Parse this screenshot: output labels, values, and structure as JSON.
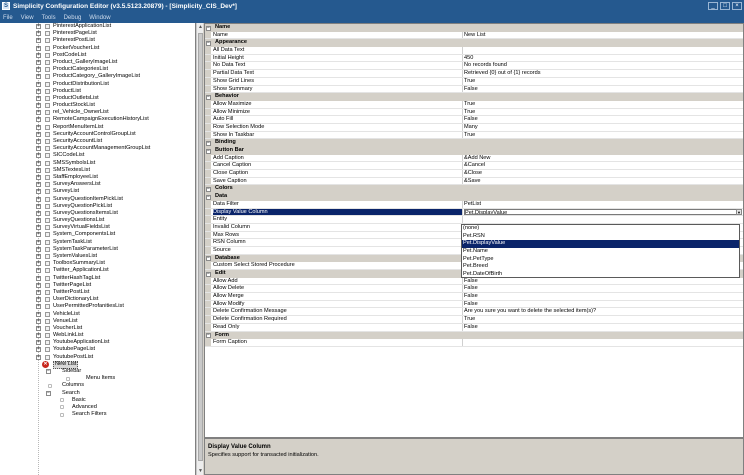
{
  "window": {
    "title": "Simplicity Configuration Editor (v3.5.5123.20879) - [Simplicity_CIS_Dev*]"
  },
  "menu": [
    "File",
    "View",
    "Tools",
    "Debug",
    "Window"
  ],
  "tree": {
    "items": [
      "PinterestApplicationList",
      "PinterestPageList",
      "PinterestPostList",
      "PocketVoucherList",
      "PostCodeList",
      "Product_GalleryImageList",
      "ProductCategoriesList",
      "ProductCategory_GalleryImageList",
      "ProductDistributionList",
      "ProductList",
      "ProductOutletsList",
      "ProductStockList",
      "rel_Vehicle_OwnerList",
      "RemoteCampaignExecutionHistoryList",
      "ReportMenuItemList",
      "SecurityAccountControlGroupList",
      "SecurityAccountList",
      "SecurityAccountManagementGroupList",
      "SICCodeList",
      "SMSSymbolsList",
      "SMSTextesList",
      "StaffEmployeeList",
      "SurveyAnswersList",
      "SurveyList",
      "SurveyQuestionItemPickList",
      "SurveyQuestionPickList",
      "SurveyQuestionsItemsList",
      "SurveyQuestionsList",
      "SurveyVirtualFieldsList",
      "System_ComponentsList",
      "SystemTaskList",
      "SystemTaskParameterList",
      "SystemValuesList",
      "ToolboxSummaryList",
      "Twitter_ApplicationList",
      "TwitterHashTagList",
      "TwitterPageList",
      "TwitterPostList",
      "UserDictionaryList",
      "UserPermittedProfanitiesList",
      "VehicleList",
      "VenueList",
      "VoucherList",
      "WebLinkList",
      "YoutubeApplicationList",
      "YoutubePageList",
      "YoutubePostList"
    ],
    "new_list": "New List",
    "children": {
      "sidebar": "Sidebar",
      "menu_items": "Menu Items",
      "columns": "Columns",
      "search": "Search",
      "basic": "Basic",
      "advanced": "Advanced",
      "search_filters": "Search Filters"
    }
  },
  "grid": {
    "rows": [
      {
        "type": "category",
        "name": "Name"
      },
      {
        "type": "prop",
        "name": "Name",
        "value": "New List"
      },
      {
        "type": "category",
        "name": "Appearance"
      },
      {
        "type": "prop",
        "name": "All Data Text",
        "value": ""
      },
      {
        "type": "prop",
        "name": "Initial Height",
        "value": "450"
      },
      {
        "type": "prop",
        "name": "No Data Text",
        "value": "No records found"
      },
      {
        "type": "prop",
        "name": "Partial Data Text",
        "value": "Retrieved {0} out of {1} records"
      },
      {
        "type": "prop",
        "name": "Show Grid Lines",
        "value": "True"
      },
      {
        "type": "prop",
        "name": "Show Summary",
        "value": "False"
      },
      {
        "type": "category",
        "name": "Behavior"
      },
      {
        "type": "prop",
        "name": "Allow Maximize",
        "value": "True"
      },
      {
        "type": "prop",
        "name": "Allow Minimize",
        "value": "True"
      },
      {
        "type": "prop",
        "name": "Auto Fill",
        "value": "False"
      },
      {
        "type": "prop",
        "name": "Row Selection Mode",
        "value": "Many"
      },
      {
        "type": "prop",
        "name": "Show In Taskbar",
        "value": "True"
      },
      {
        "type": "category",
        "name": "Binding"
      },
      {
        "type": "category",
        "name": "Button Bar"
      },
      {
        "type": "prop",
        "name": "Add Caption",
        "value": "&Add New"
      },
      {
        "type": "prop",
        "name": "Cancel Caption",
        "value": "&Cancel"
      },
      {
        "type": "prop",
        "name": "Close Caption",
        "value": "&Close"
      },
      {
        "type": "prop",
        "name": "Save Caption",
        "value": "&Save"
      },
      {
        "type": "category",
        "name": "Colors"
      },
      {
        "type": "category",
        "name": "Data"
      },
      {
        "type": "prop",
        "name": "Data Filter",
        "value": "PetList"
      },
      {
        "type": "selected",
        "name": "Display Value Column",
        "value": "Pet.DisplayValue"
      },
      {
        "type": "prop",
        "name": "Entity",
        "value": ""
      },
      {
        "type": "prop",
        "name": "Invalid Column",
        "value": ""
      },
      {
        "type": "prop",
        "name": "Max Rows",
        "value": ""
      },
      {
        "type": "prop",
        "name": "RSN Column",
        "value": ""
      },
      {
        "type": "prop",
        "name": "Source",
        "value": ""
      },
      {
        "type": "category",
        "name": "Database"
      },
      {
        "type": "prop",
        "name": "Custom Select Stored Procedure",
        "value": ""
      },
      {
        "type": "category",
        "name": "Edit"
      },
      {
        "type": "prop",
        "name": "Allow Add",
        "value": "False"
      },
      {
        "type": "prop",
        "name": "Allow Delete",
        "value": "False"
      },
      {
        "type": "prop",
        "name": "Allow Merge",
        "value": "False"
      },
      {
        "type": "prop",
        "name": "Allow Modify",
        "value": "False"
      },
      {
        "type": "prop",
        "name": "Delete Confirmation Message",
        "value": "Are you sure you want to delete the selected item(s)?"
      },
      {
        "type": "prop",
        "name": "Delete Confirmation Required",
        "value": "True"
      },
      {
        "type": "prop",
        "name": "Read Only",
        "value": "False"
      },
      {
        "type": "category",
        "name": "Form"
      },
      {
        "type": "prop",
        "name": "Form Caption",
        "value": ""
      }
    ]
  },
  "dropdown": {
    "options": [
      "(none)",
      "Pet.RSN",
      "Pet.DisplayValue",
      "Pet.Name",
      "Pet.PetType",
      "Pet.Breed",
      "Pet.DateOfBirth"
    ],
    "selected_index": 2
  },
  "help": {
    "title": "Display Value Column",
    "description": "Specifies support for transacted initialization."
  },
  "colors": {
    "titlebar": "#25598f",
    "selection": "#0a246a",
    "error": "#c8271c"
  }
}
